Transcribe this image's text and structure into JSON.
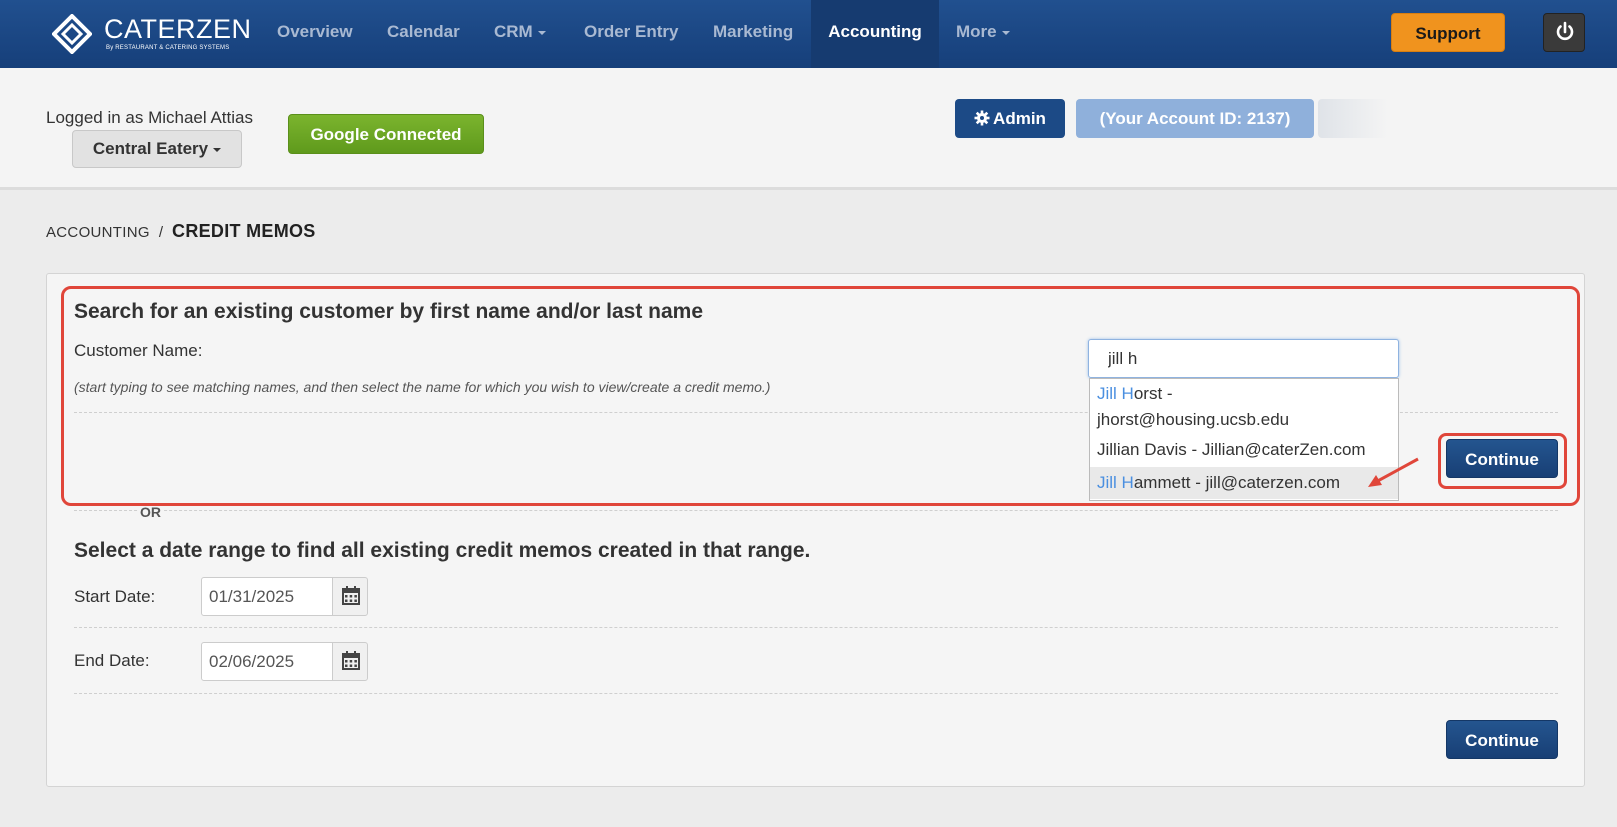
{
  "brand": {
    "name": "CATERZEN",
    "tagline": "By RESTAURANT & CATERING SYSTEMS"
  },
  "nav": {
    "items": [
      {
        "label": "Overview"
      },
      {
        "label": "Calendar"
      },
      {
        "label": "CRM"
      },
      {
        "label": "Order Entry"
      },
      {
        "label": "Marketing"
      },
      {
        "label": "Accounting",
        "active": true
      },
      {
        "label": "More"
      }
    ],
    "support_label": "Support",
    "power_icon": "power-icon"
  },
  "header": {
    "logged_in_text": "Logged in as Michael Attias",
    "location_label": "Central Eatery",
    "google_label": "Google Connected",
    "admin_label": "Admin",
    "account_id_label": "(Your Account ID: 2137)"
  },
  "breadcrumb": {
    "parent": "ACCOUNTING",
    "separator": "/",
    "current": "CREDIT MEMOS"
  },
  "customer_search": {
    "heading": "Search for an existing customer by first name and/or last name",
    "label": "Customer Name:",
    "hint": "(start typing to see matching names, and then select the name for which you wish to view/create a credit memo.)",
    "value": "jill h",
    "suggestions": [
      {
        "match": "Jill H",
        "line1_rest": "orst -",
        "line2": "jhorst@housing.ucsb.edu"
      },
      {
        "text": "Jillian Davis - Jillian@caterZen.com"
      },
      {
        "match": "Jill H",
        "rest": "ammett - jill@caterzen.com",
        "selected": true
      }
    ],
    "continue_label": "Continue"
  },
  "or_label": "OR",
  "date_range": {
    "heading": "Select a date range to find all existing credit memos created in that range.",
    "start_label": "Start Date:",
    "start_value": "01/31/2025",
    "end_label": "End Date:",
    "end_value": "02/06/2025",
    "continue_label": "Continue"
  },
  "colors": {
    "nav_bg": "#1d4a8a",
    "accent_orange": "#f0931e",
    "google_green": "#6aa321",
    "highlight_red": "#e0463a",
    "match_blue": "#4a8fe0"
  }
}
